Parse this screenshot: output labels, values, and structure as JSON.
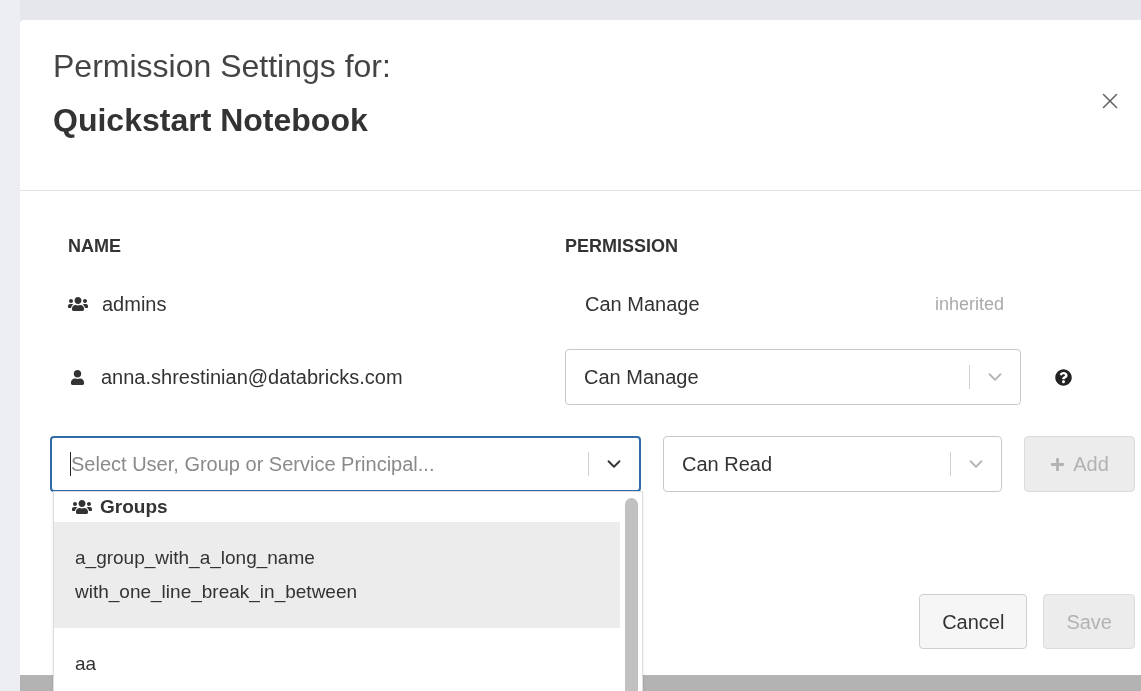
{
  "dialog": {
    "title": "Permission Settings for:",
    "subject": "Quickstart Notebook"
  },
  "columns": [
    "NAME",
    "PERMISSION"
  ],
  "entries": [
    {
      "kind": "group",
      "name": "admins",
      "permission": "Can Manage",
      "editable": false,
      "note": "inherited"
    },
    {
      "kind": "user",
      "name": "anna.shrestinian@databricks.com",
      "permission": "Can Manage",
      "editable": true
    }
  ],
  "add_row": {
    "principal": {
      "placeholder": "Select User, Group or Service Principal...",
      "focused": true
    },
    "permission": "Can Read",
    "add_button": {
      "label": "Add",
      "disabled": true
    }
  },
  "dropdown": {
    "section": "Groups",
    "options": [
      {
        "label": "a_group_with_a_long_name\nwith_one_line_break_in_between",
        "selected": true
      },
      {
        "label": "aa",
        "selected": false
      }
    ]
  },
  "buttons": [
    {
      "label": "Cancel",
      "disabled": false
    },
    {
      "label": "Save",
      "disabled": true
    }
  ]
}
